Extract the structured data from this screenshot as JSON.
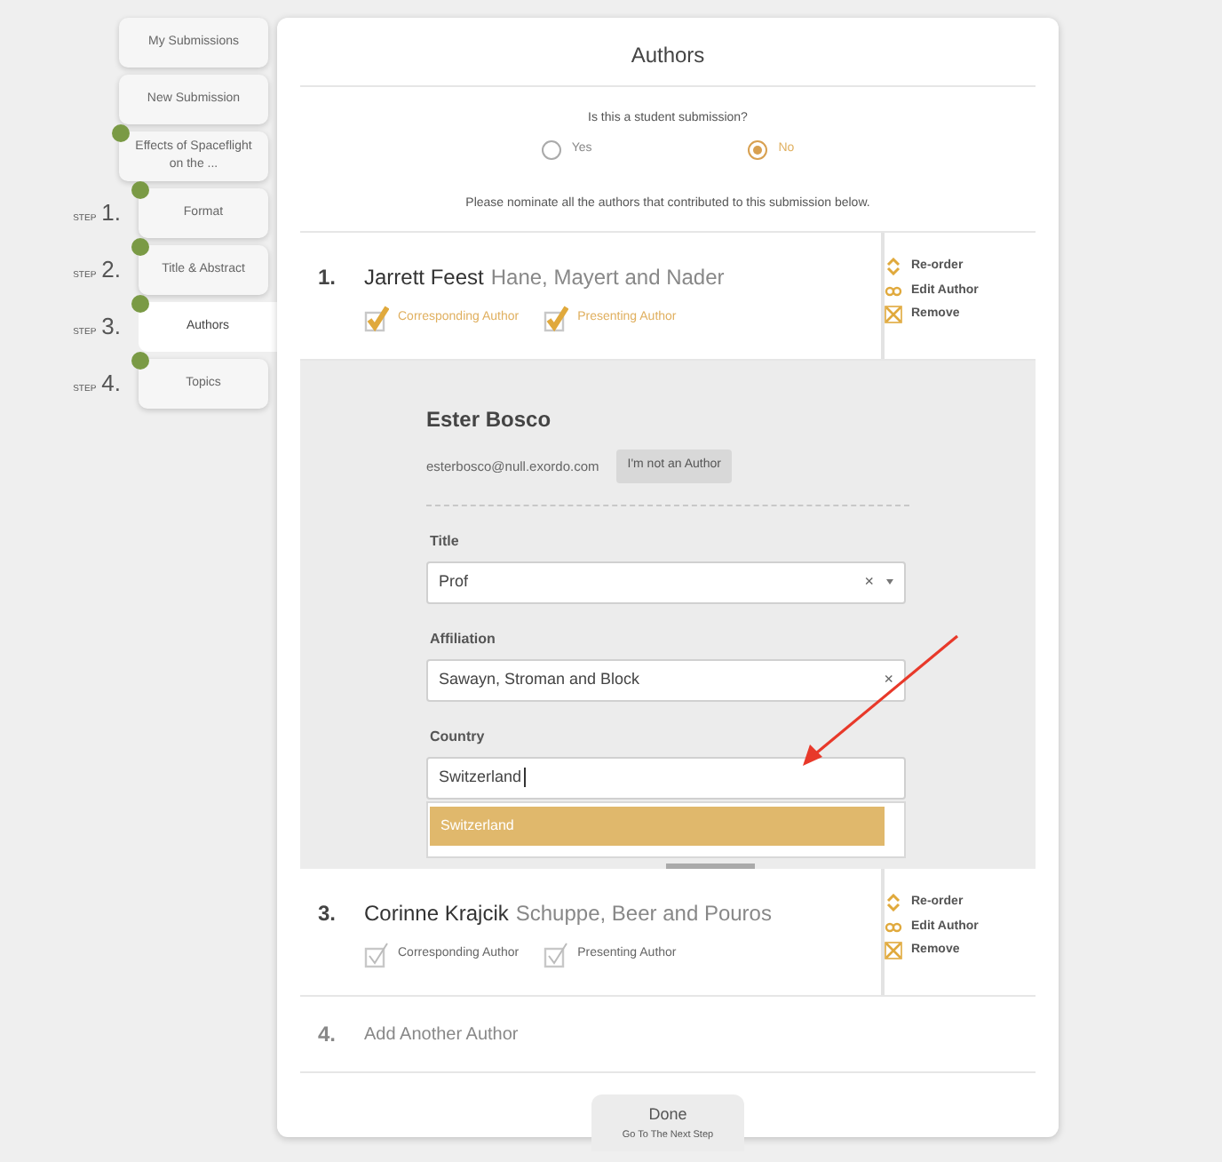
{
  "sidebar": {
    "items": [
      {
        "label": "My Submissions",
        "done": false
      },
      {
        "label": "New Submission",
        "done": false
      },
      {
        "label": "Effects of Spaceflight on the ...",
        "done": true
      }
    ],
    "steps": [
      {
        "step_word": "STEP",
        "number": "1.",
        "label": "Format",
        "done": true,
        "selected": false
      },
      {
        "step_word": "STEP",
        "number": "2.",
        "label": "Title & Abstract",
        "done": true,
        "selected": false
      },
      {
        "step_word": "STEP",
        "number": "3.",
        "label": "Authors",
        "done": true,
        "selected": true
      },
      {
        "step_word": "STEP",
        "number": "4.",
        "label": "Topics",
        "done": true,
        "selected": false
      }
    ]
  },
  "main": {
    "title": "Authors",
    "question": "Is this a student submission?",
    "radios": [
      {
        "label": "Yes",
        "selected": false
      },
      {
        "label": "No",
        "selected": true
      }
    ],
    "instruction": "Please nominate all the authors that contributed to this submission below.",
    "authors": [
      {
        "kind": "summary",
        "number": "1.",
        "name": "Jarrett Feest",
        "affiliation": "Hane, Mayert and Nader",
        "checks": [
          {
            "label": "Corresponding Author",
            "checked": true
          },
          {
            "label": "Presenting Author",
            "checked": true
          }
        ],
        "actions": [
          {
            "kind": "reorder",
            "label": "Re-order"
          },
          {
            "kind": "edit",
            "label": "Edit Author"
          },
          {
            "kind": "remove",
            "label": "Remove"
          }
        ]
      },
      {
        "kind": "editor",
        "name": "Ester Bosco",
        "email": "esterbosco@null.exordo.com",
        "button": "I'm not an Author",
        "fields": [
          {
            "kind": "select",
            "label": "Title",
            "value": "Prof",
            "clear": "×"
          },
          {
            "kind": "clearable",
            "label": "Affiliation",
            "value": "Sawayn, Stroman and Block",
            "clear": "×"
          },
          {
            "kind": "autocomplete",
            "label": "Country",
            "value": "Switzerland",
            "suggestions": [
              {
                "label": "Switzerland",
                "selected": true
              }
            ]
          }
        ]
      },
      {
        "kind": "summary",
        "number": "3.",
        "name": "Corinne Krajcik",
        "affiliation": "Schuppe, Beer and Pouros",
        "checks": [
          {
            "label": "Corresponding Author",
            "checked": false
          },
          {
            "label": "Presenting Author",
            "checked": false
          }
        ],
        "actions": [
          {
            "kind": "reorder",
            "label": "Re-order"
          },
          {
            "kind": "edit",
            "label": "Edit Author"
          },
          {
            "kind": "remove",
            "label": "Remove"
          }
        ]
      },
      {
        "kind": "add",
        "number": "4.",
        "label": "Add Another Author"
      }
    ],
    "done_button": {
      "label": "Done",
      "sublabel": "Go To The Next Step"
    }
  }
}
